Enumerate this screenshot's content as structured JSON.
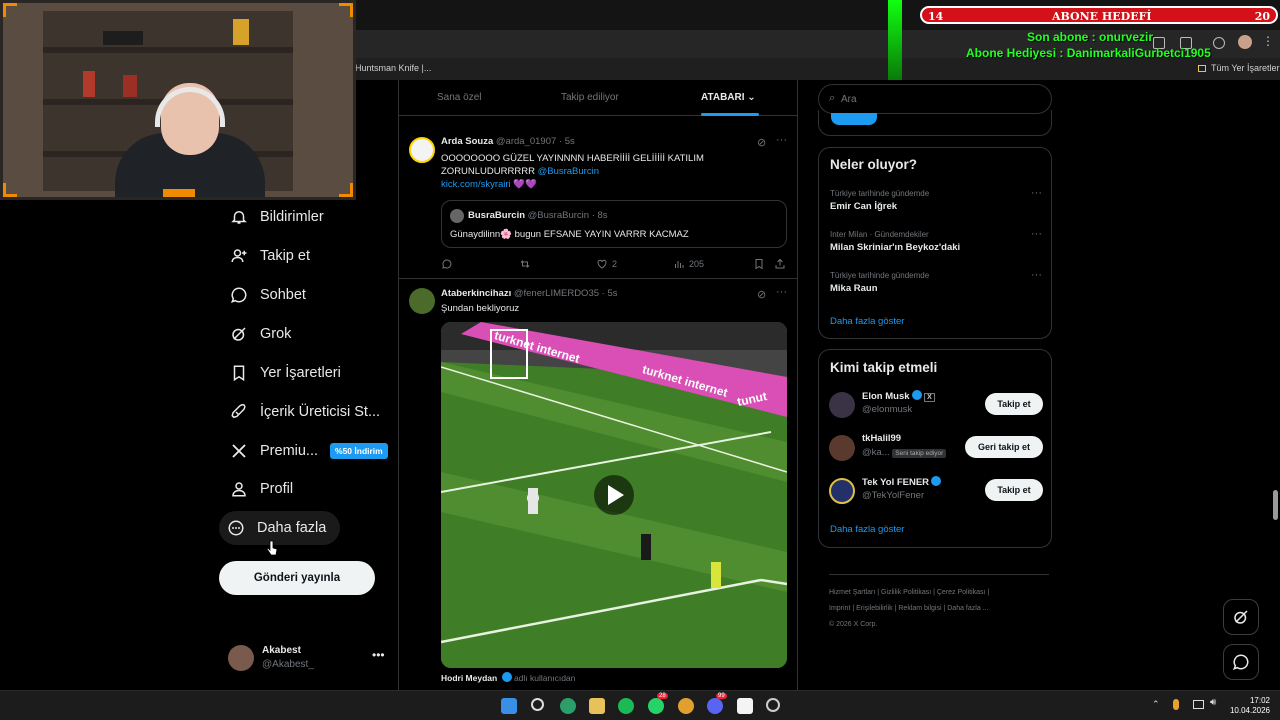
{
  "browser": {
    "bookmarks": [
      "Huntsman Knife |...",
      "Tüm Yer İşaretleri"
    ]
  },
  "overlay": {
    "sub_goal_left": "14",
    "sub_goal_title": "ABONE HEDEFİ",
    "sub_goal_right": "20",
    "last_sub": "Son abone : onurvezir",
    "gift_sub": "Abone Hediyesi : DanimarkaliGurbetci1905"
  },
  "nav": {
    "items": [
      {
        "label": "Bildirimler",
        "icon": "bell-icon"
      },
      {
        "label": "Takip et",
        "icon": "add-user-icon"
      },
      {
        "label": "Sohbet",
        "icon": "chat-icon"
      },
      {
        "label": "Grok",
        "icon": "grok-icon"
      },
      {
        "label": "Yer İşaretleri",
        "icon": "bookmark-icon"
      },
      {
        "label": "İçerik Üreticisi St...",
        "icon": "rocket-icon"
      },
      {
        "label": "Premiu...",
        "icon": "x-logo-icon",
        "badge": "%50 İndirim"
      },
      {
        "label": "Profil",
        "icon": "person-icon"
      },
      {
        "label": "Daha fazla",
        "icon": "more-circle-icon"
      }
    ],
    "post_button": "Gönderi yayınla",
    "account": {
      "name": "Akabest",
      "handle": "@Akabest_"
    }
  },
  "feed": {
    "tabs": [
      "Sana özel",
      "Takip ediliyor",
      "ATABARI"
    ],
    "tweets": [
      {
        "name": "Arda Souza",
        "handle": "@arda_01907",
        "time": "· 5s",
        "text_line1": "OOOOOOOO GÜZEL YAYINNNN HABERİİİİ GELİİİİİ KATILIM",
        "text_line2": "ZORUNLUDURRRRR",
        "mention": "@BusraBurcin",
        "link": "kick.com/skyrairi",
        "quote": {
          "name": "BusraBurcin",
          "handle": "@BusraBurcin",
          "time": "· 8s",
          "text": "Günaydilinn🌸 bugun EFSANE YAYIN VARRR KACMAZ"
        },
        "likes": "2",
        "views": "205"
      },
      {
        "name": "Ataberkincihazı",
        "handle": "@fenerLIMERDO35",
        "time": "· 5s",
        "text": "Şundan bekliyoruz",
        "video_ad_1": "turknet internet",
        "video_ad_2": "turknet internet",
        "video_ad_3": "tunut",
        "caption_name": "Hodri Meydan",
        "caption_sub": "adlı kullanıcıdan"
      }
    ]
  },
  "sidebar": {
    "search_placeholder": "Ara",
    "trends_title": "Neler oluyor?",
    "trends": [
      {
        "context": "Türkiye tarihinde gündemde",
        "topic": "Emir Can İğrek"
      },
      {
        "context": "Inter Milan · Gündemdekiler",
        "topic": "Milan Skriniar'ın Beykoz'daki"
      },
      {
        "context": "Türkiye tarihinde gündemde",
        "topic": "Mika Raun"
      }
    ],
    "trends_more": "Daha fazla göster",
    "who_title": "Kimi takip etmeli",
    "who": [
      {
        "name": "Elon Musk",
        "handle": "@elonmusk",
        "button": "Takip et"
      },
      {
        "name": "tkHalil99",
        "handle": "@ka...",
        "sub_badge": "Seni takip ediyor",
        "button": "Geri takip et"
      },
      {
        "name": "Tek Yol FENER",
        "handle": "@TekYolFener",
        "button": "Takip et"
      }
    ],
    "who_more": "Daha fazla göster",
    "footer": {
      "line1": "Hizmet Şartları  |  Gizlilik Politikası  |  Çerez Politikası  |",
      "line2": "Imprint  |  Erişilebilirlik  |  Reklam bilgisi  |  Daha fazla ...",
      "line3": "© 2026 X Corp."
    }
  },
  "taskbar": {
    "time": "17:02",
    "date": "10.04.2026",
    "badge_whatsapp": "28",
    "badge_discord": "99"
  },
  "colors": {
    "accent": "#1d9bf0",
    "overlay_green": "#22ff22",
    "sub_bar": "#d41018"
  }
}
